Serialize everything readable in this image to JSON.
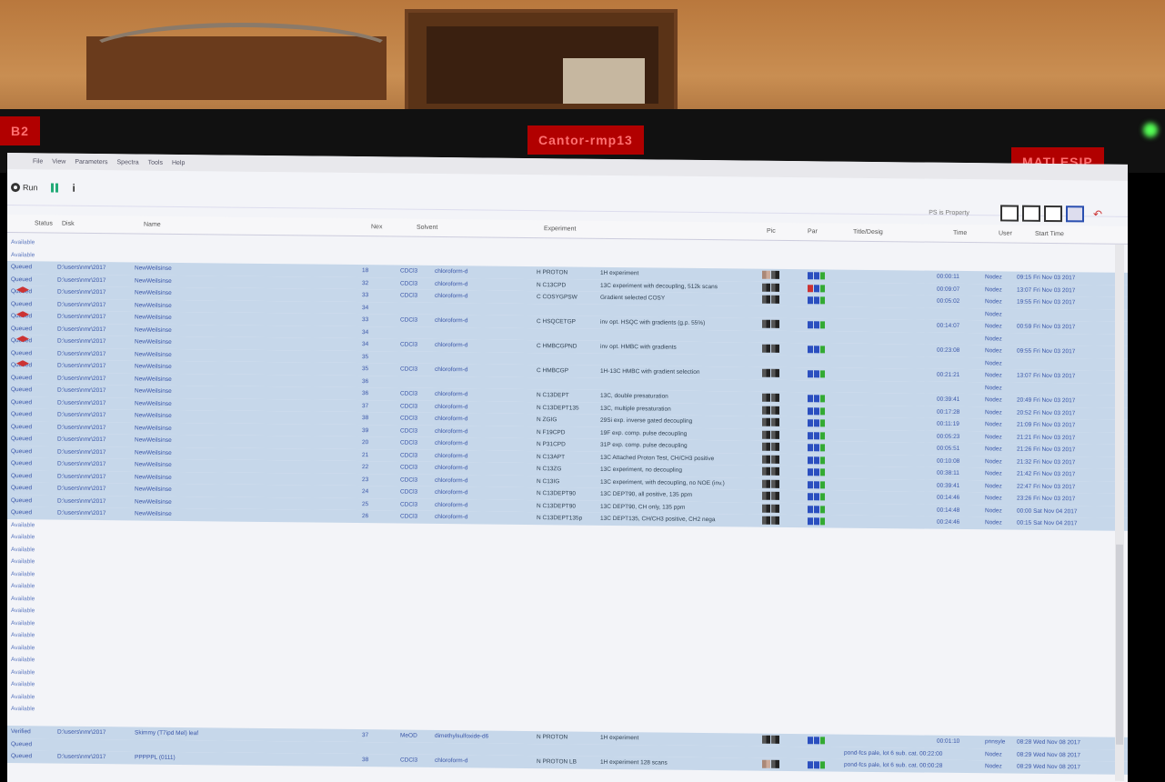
{
  "bezel": {
    "left_label": "B2",
    "center_label": "Cantor-rmp13",
    "right_label": "MATLESIP"
  },
  "menu": [
    "File",
    "View",
    "Parameters",
    "Spectra",
    "Tools",
    "Help"
  ],
  "toolbar": {
    "run_label": "Run",
    "info_icon": "info-icon",
    "right_label": "PS is Property"
  },
  "columns": [
    "Status",
    "Disk",
    "Name",
    "Nex",
    "Solvent",
    "Experiment",
    "Pic",
    "Par",
    "Title/Desig",
    "Time",
    "User",
    "Start Time"
  ],
  "colors": {
    "selection": "#c6d7ea",
    "bezel_label": "#b10000"
  },
  "rows": [
    {
      "status": "Available",
      "sel": false
    },
    {
      "status": "Available",
      "sel": false
    },
    {
      "status": "Queued",
      "sel": true,
      "disk": "D:\\users\\nmr\\2017",
      "name": "NewWeilsinse",
      "nex": "18",
      "solvent": "CDCl3",
      "solv2": "chloroform-d",
      "exp": "H PROTON",
      "desc": "1H experiment",
      "time": "00:00:11",
      "user": "Nodez",
      "start": "09:15 Fri Nov 03 2017"
    },
    {
      "status": "Queued",
      "sel": true,
      "disk": "D:\\users\\nmr\\2017",
      "name": "NewWeilsinse",
      "nex": "32",
      "solvent": "CDCl3",
      "solv2": "chloroform-d",
      "exp": "N C13CPD",
      "desc": "13C experiment with decoupling, 512k scans",
      "time": "00:09:07",
      "user": "Nodez",
      "start": "13:07 Fri Nov 03 2017"
    },
    {
      "status": "Queued",
      "sel": true,
      "disk": "D:\\users\\nmr\\2017",
      "name": "NewWeilsinse",
      "nex": "33",
      "solvent": "CDCl3",
      "solv2": "chloroform-d",
      "exp": "C COSYGPSW",
      "desc": "Gradient selected COSY",
      "time": "00:05:02",
      "user": "Nodez",
      "start": "19:55 Fri Nov 03 2017"
    },
    {
      "status": "Queued",
      "sel": true,
      "disk": "D:\\users\\nmr\\2017",
      "name": "NewWeilsinse",
      "nex": "34",
      "solvent": "",
      "solv2": "",
      "exp": "",
      "desc": "",
      "time": "",
      "user": "Nodez",
      "start": ""
    },
    {
      "status": "Queued",
      "sel": true,
      "disk": "D:\\users\\nmr\\2017",
      "name": "NewWeilsinse",
      "nex": "33",
      "solvent": "CDCl3",
      "solv2": "chloroform-d",
      "exp": "C HSQCETGP",
      "desc": "inv opt. HSQC with gradients (g.p. 55%)",
      "time": "00:14:07",
      "user": "Nodez",
      "start": "00:59 Fri Nov 03 2017"
    },
    {
      "status": "Queued",
      "sel": true,
      "disk": "D:\\users\\nmr\\2017",
      "name": "NewWeilsinse",
      "nex": "34",
      "solvent": "",
      "solv2": "",
      "exp": "",
      "desc": "",
      "time": "",
      "user": "Nodez",
      "start": ""
    },
    {
      "status": "Queued",
      "sel": true,
      "disk": "D:\\users\\nmr\\2017",
      "name": "NewWeilsinse",
      "nex": "34",
      "solvent": "CDCl3",
      "solv2": "chloroform-d",
      "exp": "C HMBCGPND",
      "desc": "inv opt. HMBC with gradients",
      "time": "00:23:08",
      "user": "Nodez",
      "start": "09:55 Fri Nov 03 2017"
    },
    {
      "status": "Queued",
      "sel": true,
      "disk": "D:\\users\\nmr\\2017",
      "name": "NewWeilsinse",
      "nex": "35",
      "solvent": "",
      "solv2": "",
      "exp": "",
      "desc": "",
      "time": "",
      "user": "Nodez",
      "start": ""
    },
    {
      "status": "Queued",
      "sel": true,
      "disk": "D:\\users\\nmr\\2017",
      "name": "NewWeilsinse",
      "nex": "35",
      "solvent": "CDCl3",
      "solv2": "chloroform-d",
      "exp": "C HMBCGP",
      "desc": "1H-13C HMBC with gradient selection",
      "time": "00:21:21",
      "user": "Nodez",
      "start": "13:07 Fri Nov 03 2017"
    },
    {
      "status": "Queued",
      "sel": true,
      "disk": "D:\\users\\nmr\\2017",
      "name": "NewWeilsinse",
      "nex": "36",
      "solvent": "",
      "solv2": "",
      "exp": "",
      "desc": "",
      "time": "",
      "user": "Nodez",
      "start": ""
    },
    {
      "status": "Queued",
      "sel": true,
      "disk": "D:\\users\\nmr\\2017",
      "name": "NewWeilsinse",
      "nex": "36",
      "solvent": "CDCl3",
      "solv2": "chloroform-d",
      "exp": "N C13DEPT",
      "desc": "13C, double presaturation",
      "time": "00:39:41",
      "user": "Nodez",
      "start": "20:49 Fri Nov 03 2017"
    },
    {
      "status": "Queued",
      "sel": true,
      "disk": "D:\\users\\nmr\\2017",
      "name": "NewWeilsinse",
      "nex": "37",
      "solvent": "CDCl3",
      "solv2": "chloroform-d",
      "exp": "N C13DEPT135",
      "desc": "13C, multiple presaturation",
      "time": "00:17:28",
      "user": "Nodez",
      "start": "20:52 Fri Nov 03 2017"
    },
    {
      "status": "Queued",
      "sel": true,
      "disk": "D:\\users\\nmr\\2017",
      "name": "NewWeilsinse",
      "nex": "38",
      "solvent": "CDCl3",
      "solv2": "chloroform-d",
      "exp": "N ZGIG",
      "desc": "29Si exp. inverse gated decoupling",
      "time": "00:11:19",
      "user": "Nodez",
      "start": "21:09 Fri Nov 03 2017"
    },
    {
      "status": "Queued",
      "sel": true,
      "disk": "D:\\users\\nmr\\2017",
      "name": "NewWeilsinse",
      "nex": "39",
      "solvent": "CDCl3",
      "solv2": "chloroform-d",
      "exp": "N F19CPD",
      "desc": "19F exp. comp. pulse decoupling",
      "time": "00:05:23",
      "user": "Nodez",
      "start": "21:21 Fri Nov 03 2017"
    },
    {
      "status": "Queued",
      "sel": true,
      "disk": "D:\\users\\nmr\\2017",
      "name": "NewWeilsinse",
      "nex": "20",
      "solvent": "CDCl3",
      "solv2": "chloroform-d",
      "exp": "N P31CPD",
      "desc": "31P exp. comp. pulse decoupling",
      "time": "00:05:51",
      "user": "Nodez",
      "start": "21:26 Fri Nov 03 2017"
    },
    {
      "status": "Queued",
      "sel": true,
      "disk": "D:\\users\\nmr\\2017",
      "name": "NewWeilsinse",
      "nex": "21",
      "solvent": "CDCl3",
      "solv2": "chloroform-d",
      "exp": "N C13APT",
      "desc": "13C Attached Proton Test, CH/CH3 positive",
      "time": "00:10:08",
      "user": "Nodez",
      "start": "21:32 Fri Nov 03 2017"
    },
    {
      "status": "Queued",
      "sel": true,
      "disk": "D:\\users\\nmr\\2017",
      "name": "NewWeilsinse",
      "nex": "22",
      "solvent": "CDCl3",
      "solv2": "chloroform-d",
      "exp": "N C13ZG",
      "desc": "13C experiment, no decoupling",
      "time": "00:38:11",
      "user": "Nodez",
      "start": "21:42 Fri Nov 03 2017"
    },
    {
      "status": "Queued",
      "sel": true,
      "disk": "D:\\users\\nmr\\2017",
      "name": "NewWeilsinse",
      "nex": "23",
      "solvent": "CDCl3",
      "solv2": "chloroform-d",
      "exp": "N C13IG",
      "desc": "13C experiment, with decoupling, no NOE (inv.)",
      "time": "00:39:41",
      "user": "Nodez",
      "start": "22:47 Fri Nov 03 2017"
    },
    {
      "status": "Queued",
      "sel": true,
      "disk": "D:\\users\\nmr\\2017",
      "name": "NewWeilsinse",
      "nex": "24",
      "solvent": "CDCl3",
      "solv2": "chloroform-d",
      "exp": "N C13DEPT90",
      "desc": "13C DEPT90, all positive, 135 ppm",
      "time": "00:14:46",
      "user": "Nodez",
      "start": "23:26 Fri Nov 03 2017"
    },
    {
      "status": "Queued",
      "sel": true,
      "disk": "D:\\users\\nmr\\2017",
      "name": "NewWeilsinse",
      "nex": "25",
      "solvent": "CDCl3",
      "solv2": "chloroform-d",
      "exp": "N C13DEPT90",
      "desc": "13C DEPT90, CH only, 135 ppm",
      "time": "00:14:48",
      "user": "Nodez",
      "start": "00:00 Sat Nov 04 2017"
    },
    {
      "status": "Queued",
      "sel": true,
      "disk": "D:\\users\\nmr\\2017",
      "name": "NewWeilsinse",
      "nex": "26",
      "solvent": "CDCl3",
      "solv2": "chloroform-d",
      "exp": "N C13DEPT135p",
      "desc": "13C DEPT135, CH/CH3 positive, CH2 nega",
      "time": "00:24:46",
      "user": "Nodez",
      "start": "00:15 Sat Nov 04 2017"
    }
  ],
  "available_count": 16,
  "bottom_rows": [
    {
      "status": "Verified",
      "disk": "D:\\users\\nmr\\2017",
      "name": "Skimmy (T7ipd Mel) leaf",
      "nex": "37",
      "solvent": "MeOD",
      "solv2": "dimethylsulfoxide-d6",
      "exp": "N PROTON",
      "desc": "1H experiment",
      "title": "",
      "time": "00:01:10",
      "user": "pnnsyle",
      "start": "08:28 Wed Nov 08 2017"
    },
    {
      "status": "Queued",
      "disk": "",
      "name": "",
      "nex": "",
      "solvent": "",
      "solv2": "",
      "exp": "",
      "desc": "",
      "title": "pond-fcs pale, lot 6 sub. cat. 00:22:00",
      "time": "",
      "user": "Nodez",
      "start": "08:29 Wed Nov 08 2017"
    },
    {
      "status": "Queued",
      "disk": "D:\\users\\nmr\\2017",
      "name": "PPPPPL (0111)",
      "nex": "38",
      "solvent": "CDCl3",
      "solv2": "chloroform-d",
      "exp": "N PROTON LB",
      "desc": "1H experiment 128 scans",
      "title": "pond-fcs pale, lot 6 sub. cat. 00:00:28",
      "time": "",
      "user": "Nodez",
      "start": "08:29 Wed Nov 08 2017"
    }
  ]
}
